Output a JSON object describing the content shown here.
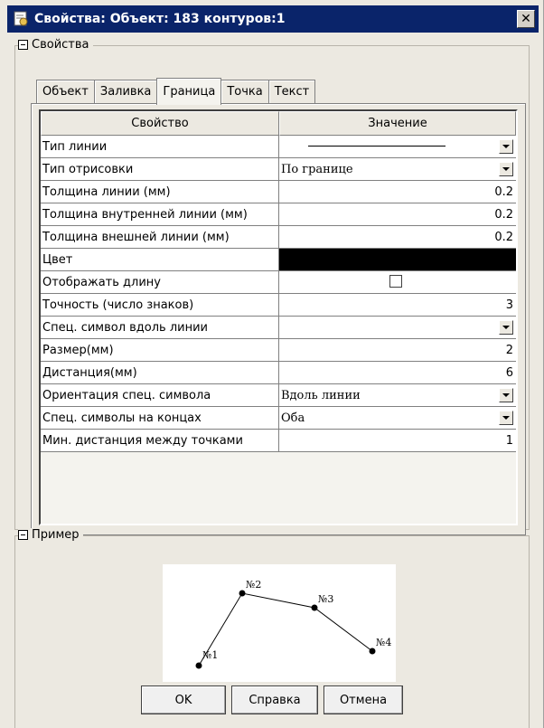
{
  "window": {
    "title": "Свойства: Объект: 183 контуров:1",
    "close_glyph": "✕"
  },
  "properties_group": {
    "title": "Свойства"
  },
  "tabs": [
    {
      "label": "Объект",
      "active": false
    },
    {
      "label": "Заливка",
      "active": false
    },
    {
      "label": "Граница",
      "active": true
    },
    {
      "label": "Точка",
      "active": false
    },
    {
      "label": "Текст",
      "active": false
    }
  ],
  "grid": {
    "columns": [
      "Свойство",
      "Значение"
    ],
    "rows": [
      {
        "name": "Тип линии",
        "value": "",
        "kind": "line-dropdown"
      },
      {
        "name": "Тип отрисовки",
        "value": "По границе",
        "kind": "dropdown"
      },
      {
        "name": "Толщина линии (мм)",
        "value": "0.2",
        "kind": "number"
      },
      {
        "name": "Толщина внутренней линии (мм)",
        "value": "0.2",
        "kind": "number"
      },
      {
        "name": "Толщина внешней линии (мм)",
        "value": "0.2",
        "kind": "number"
      },
      {
        "name": "Цвет",
        "value": "#000000",
        "kind": "color"
      },
      {
        "name": "Отображать длину",
        "value": "",
        "kind": "checkbox"
      },
      {
        "name": "Точность (число знаков)",
        "value": "3",
        "kind": "number"
      },
      {
        "name": "Спец. символ вдоль линии",
        "value": "",
        "kind": "dropdown"
      },
      {
        "name": "Размер(мм)",
        "value": "2",
        "kind": "number"
      },
      {
        "name": "Дистанция(мм)",
        "value": "6",
        "kind": "number"
      },
      {
        "name": "Ориентация спец. символа",
        "value": "Вдоль линии",
        "kind": "dropdown"
      },
      {
        "name": "Спец. символы на концах",
        "value": "Оба",
        "kind": "dropdown"
      },
      {
        "name": "Мин. дистанция между точками",
        "value": "1",
        "kind": "number"
      }
    ]
  },
  "example_group": {
    "title": "Пример",
    "points": [
      "№1",
      "№2",
      "№3",
      "№4"
    ]
  },
  "buttons": {
    "ok": "OK",
    "help": "Справка",
    "cancel": "Отмена"
  }
}
